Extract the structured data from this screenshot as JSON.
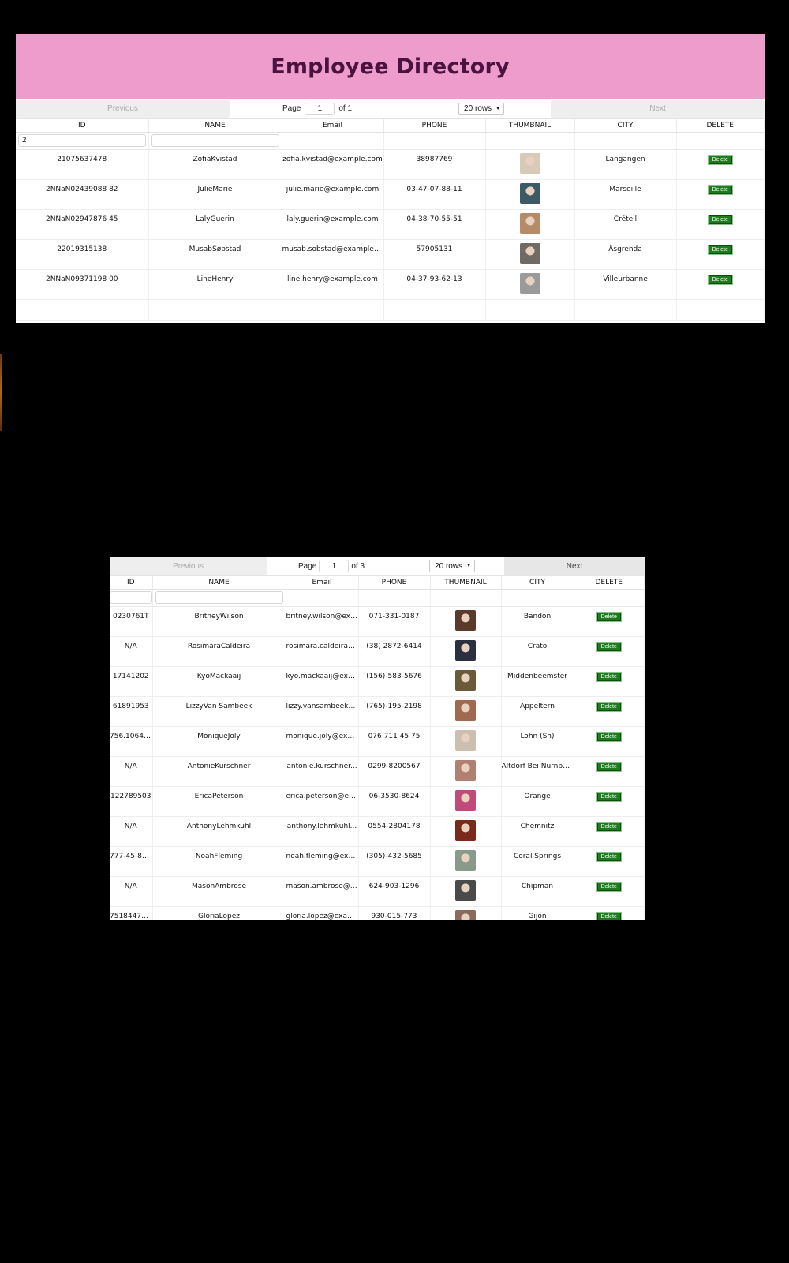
{
  "title": "Employee Directory",
  "headers": [
    "ID",
    "NAME",
    "Email",
    "PHONE",
    "THUMBNAIL",
    "CITY",
    "DELETE"
  ],
  "delete_label": "Delete",
  "top": {
    "prev_label": "Previous",
    "next_label": "Next",
    "page_label": "Page",
    "page_value": "1",
    "of_label": "of 1",
    "rows_label": "20 rows",
    "filter_id": "2",
    "filter_name": "",
    "rows": [
      {
        "id": "21075637478",
        "name": "ZofiaKvistad",
        "email": "zofia.kvistad@example.com",
        "phone": "38987769",
        "city": "Langangen",
        "thumb_color": "#d9c9b9"
      },
      {
        "id": "2NNaN02439088 82",
        "name": "JulieMarie",
        "email": "julie.marie@example.com",
        "phone": "03-47-07-88-11",
        "city": "Marseille",
        "thumb_color": "#3c5a66"
      },
      {
        "id": "2NNaN02947876 45",
        "name": "LalyGuerin",
        "email": "laly.guerin@example.com",
        "phone": "04-38-70-55-51",
        "city": "Créteil",
        "thumb_color": "#b58b6a"
      },
      {
        "id": "22019315138",
        "name": "MusabSøbstad",
        "email": "musab.sobstad@example.com",
        "phone": "57905131",
        "city": "Åsgrenda",
        "thumb_color": "#6f6a64"
      },
      {
        "id": "2NNaN09371198 00",
        "name": "LineHenry",
        "email": "line.henry@example.com",
        "phone": "04-37-93-62-13",
        "city": "Villeurbanne",
        "thumb_color": "#9a9a9a"
      }
    ]
  },
  "bottom": {
    "prev_label": "Previous",
    "next_label": "Next",
    "page_label": "Page",
    "page_value": "1",
    "of_label": "of 3",
    "rows_label": "20 rows",
    "rows": [
      {
        "id": "0230761T",
        "name": "BritneyWilson",
        "email": "britney.wilson@exa...",
        "phone": "071-331-0187",
        "city": "Bandon",
        "thumb_color": "#5a3a2a"
      },
      {
        "id": "N/A",
        "name": "RosimaraCaldeira",
        "email": "rosimara.caldeira@...",
        "phone": "(38) 2872-6414",
        "city": "Crato",
        "thumb_color": "#2a3040"
      },
      {
        "id": "17141202",
        "name": "KyoMackaaij",
        "email": "kyo.mackaaij@exa...",
        "phone": "(156)-583-5676",
        "city": "Middenbeemster",
        "thumb_color": "#6a5a3a"
      },
      {
        "id": "61891953",
        "name": "LizzyVan Sambeek",
        "email": "lizzy.vansambeek@...",
        "phone": "(765)-195-2198",
        "city": "Appeltern",
        "thumb_color": "#a06a50"
      },
      {
        "id": "756.1064.0...",
        "name": "MoniqueJoly",
        "email": "monique.joly@exa...",
        "phone": "076 711 45 75",
        "city": "Lohn (Sh)",
        "thumb_color": "#cdbfb0"
      },
      {
        "id": "N/A",
        "name": "AntonieKürschner",
        "email": "antonie.kurschner...",
        "phone": "0299-8200567",
        "city": "Altdorf Bei Nürnberg",
        "thumb_color": "#b08070"
      },
      {
        "id": "122789503",
        "name": "EricaPeterson",
        "email": "erica.peterson@exa...",
        "phone": "06-3530-8624",
        "city": "Orange",
        "thumb_color": "#c04a7a"
      },
      {
        "id": "N/A",
        "name": "AnthonyLehmkuhl",
        "email": "anthony.lehmkuhl...",
        "phone": "0554-2804178",
        "city": "Chemnitz",
        "thumb_color": "#7a2a1a"
      },
      {
        "id": "777-45-82...",
        "name": "NoahFleming",
        "email": "noah.fleming@exa...",
        "phone": "(305)-432-5685",
        "city": "Coral Springs",
        "thumb_color": "#8a9a8a"
      },
      {
        "id": "N/A",
        "name": "MasonAmbrose",
        "email": "mason.ambrose@e...",
        "phone": "624-903-1296",
        "city": "Chipman",
        "thumb_color": "#4a4a4a"
      },
      {
        "id": "75184476-F",
        "name": "GloriaLopez",
        "email": "gloria.lopez@exam...",
        "phone": "930-015-773",
        "city": "Gijón",
        "thumb_color": "#8a6a5a"
      }
    ]
  }
}
